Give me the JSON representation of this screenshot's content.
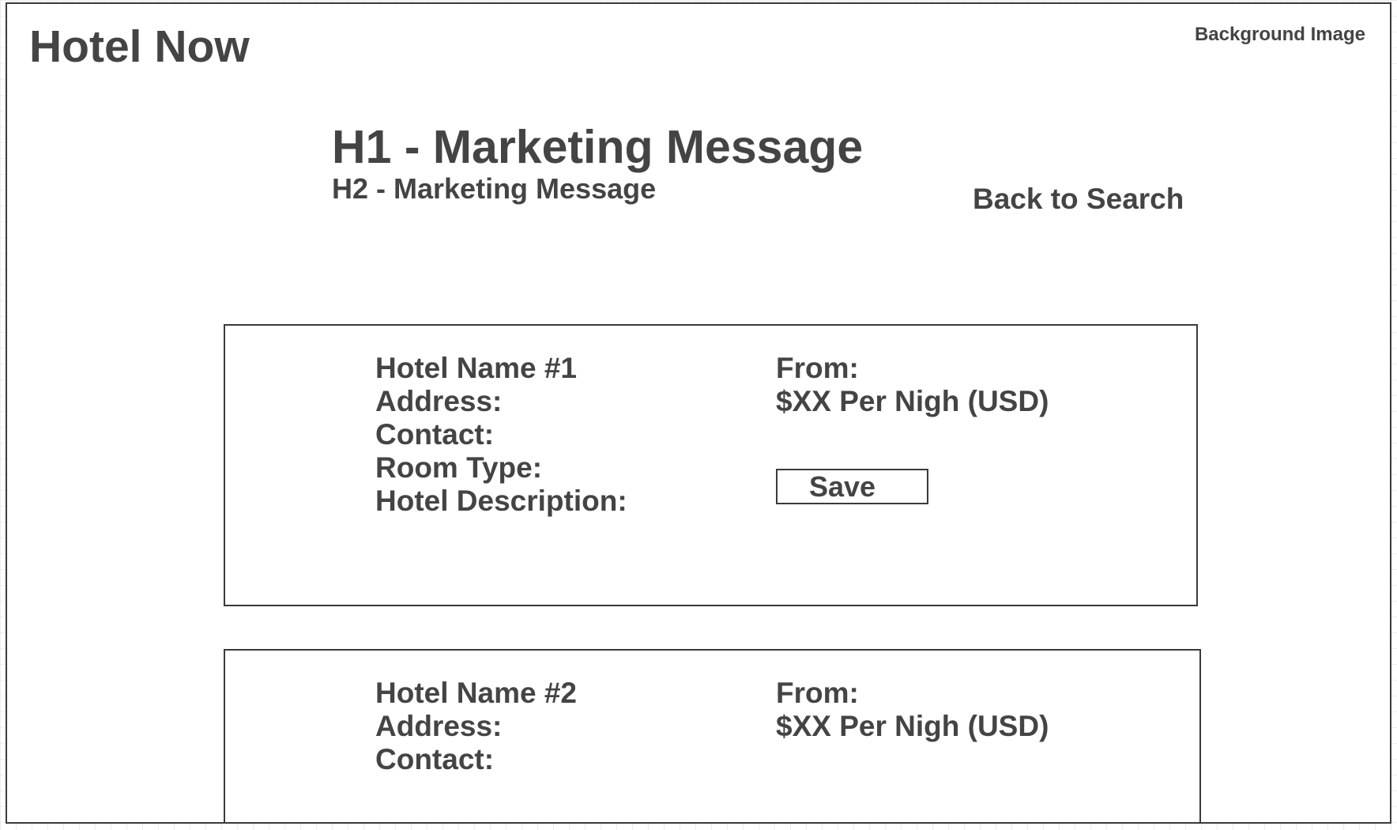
{
  "header": {
    "logo": "Hotel Now",
    "background_label": "Background Image"
  },
  "hero": {
    "h1": "H1 - Marketing Message",
    "h2": "H2 - Marketing Message",
    "back_link": "Back to Search"
  },
  "hotels": [
    {
      "name": "Hotel Name #1",
      "address_label": "Address:",
      "contact_label": "Contact:",
      "room_type_label": "Room Type:",
      "description_label": "Hotel Description:",
      "from_label": "From:",
      "price": "$XX Per Nigh (USD)",
      "save_label": "Save"
    },
    {
      "name": "Hotel Name #2",
      "address_label": "Address:",
      "contact_label": "Contact:",
      "from_label": "From:",
      "price": "$XX Per Nigh (USD)"
    }
  ]
}
